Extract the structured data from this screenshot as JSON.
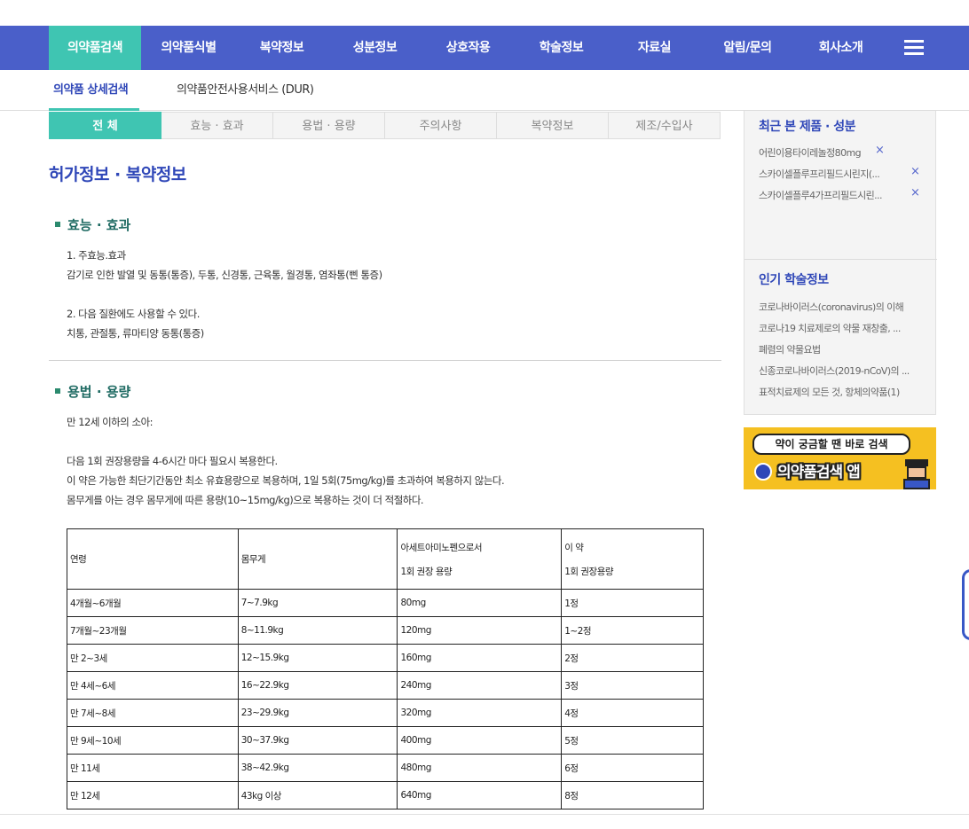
{
  "gnb": {
    "items": [
      "의약품검색",
      "의약품식별",
      "복약정보",
      "성분정보",
      "상호작용",
      "학술정보",
      "자료실",
      "알림/문의",
      "회사소개"
    ],
    "menu_icon": "hamburger-icon"
  },
  "lnb": {
    "items": [
      "의약품 상세검색",
      "의약품안전사용서비스 (DUR)"
    ]
  },
  "tabs": [
    "전 체",
    "효능 · 효과",
    "용법 · 용량",
    "주의사항",
    "복약정보",
    "제조/수입사"
  ],
  "page_title": "허가정보 · 복약정보",
  "efficacy": {
    "title": "효능 · 효과",
    "lines": [
      "1. 주효능.효과",
      "감기로 인한 발열 및 동통(통증), 두통, 신경통, 근육통, 월경통, 염좌통(삔 통증)",
      "2. 다음 질환에도 사용할 수 있다.",
      "치통, 관절통, 류마티양 동통(통증)"
    ]
  },
  "dosage": {
    "title": "용법 · 용량",
    "lines": [
      "만 12세 이하의 소아:",
      "다음 1회 권장용량을 4-6시간 마다 필요시 복용한다.",
      "이 약은 가능한 최단기간동안 최소 유효용량으로 복용하며, 1일 5회(75mg/kg)를 초과하여 복용하지 않는다.",
      "몸무게를 아는 경우 몸무게에 따른 용량(10~15mg/kg)으로 복용하는 것이 더 적절하다."
    ],
    "table": {
      "headers": [
        [
          "연령"
        ],
        [
          "몸무게"
        ],
        [
          "아세트아미노펜으로서",
          "1회 권장 용량"
        ],
        [
          "이 약",
          "1회 권장용량"
        ]
      ],
      "rows": [
        [
          "4개월~6개월",
          "7~7.9kg",
          "80mg",
          "1정"
        ],
        [
          "7개월~23개월",
          "8~11.9kg",
          "120mg",
          "1~2정"
        ],
        [
          "만 2~3세",
          "12~15.9kg",
          "160mg",
          "2정"
        ],
        [
          "만 4세~6세",
          "16~22.9kg",
          "240mg",
          "3정"
        ],
        [
          "만 7세~8세",
          "23~29.9kg",
          "320mg",
          "4정"
        ],
        [
          "만 9세~10세",
          "30~37.9kg",
          "400mg",
          "5정"
        ],
        [
          "만 11세",
          "38~42.9kg",
          "480mg",
          "6정"
        ],
        [
          "만 12세",
          "43kg 이상",
          "640mg",
          "8정"
        ]
      ]
    }
  },
  "aside": {
    "recent_title": "최근 본 제품 · 성분",
    "recent_items": [
      "어린이용타이레놀정80mg",
      "스카이셀플루프리필드시린지(...",
      "스카이셀플루4가프리필드시린..."
    ],
    "remove_symbol": "×",
    "popular_title": "인기 학술정보",
    "popular_items": [
      "코로나바이러스(coronavirus)의 이해",
      "코로나19 치료제로의 약물 재창출, ...",
      "폐렴의 약물요법",
      "신종코로나바이러스(2019-nCoV)의 ...",
      "표적치료제의 모든 것, 항체의약품(1)"
    ]
  },
  "banner": {
    "bubble": "약이 궁금할 땐 바로 검색",
    "main": "의약품검색 앱"
  },
  "colors": {
    "primary": "#4a5fc9",
    "accent": "#3fc5b2",
    "title": "#2f47b8",
    "section": "#1e6a62",
    "banner": "#f5c021"
  }
}
